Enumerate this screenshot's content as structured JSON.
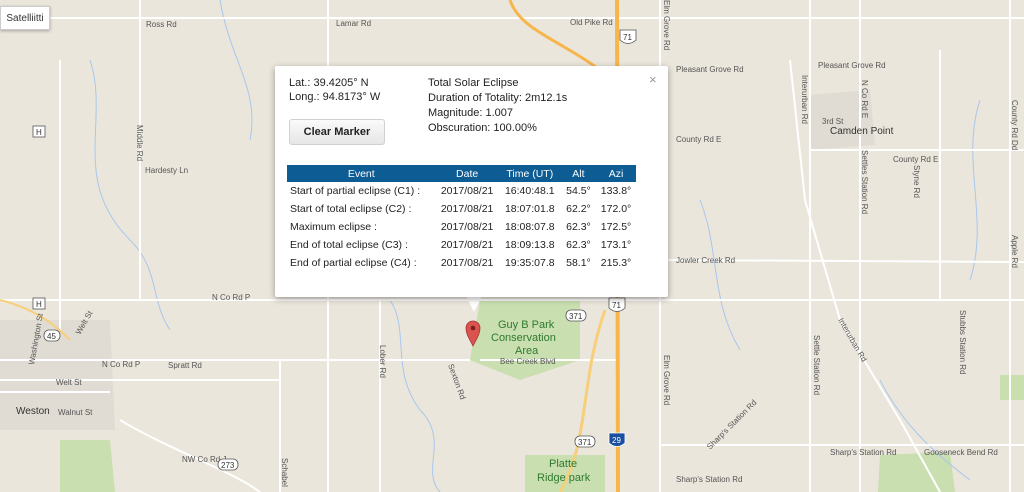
{
  "controls": {
    "satellite_label": "Satelliitti"
  },
  "map_labels": {
    "ross_rd": "Ross Rd",
    "lamar_rd": "Lamar Rd",
    "old_pike_rd": "Old Pike Rd",
    "pleasant_grove_rd": "Pleasant Grove Rd",
    "pleasant_grove_rd_2": "Pleasant Grove Rd",
    "interurban_rd": "Interurban Rd",
    "n_co_rd_e": "N Co Rd E",
    "camden_point": "Camden Point",
    "county_rd_e": "County Rd E",
    "county_rd_e_2": "County Rd E",
    "settles_station_rd": "Settles Station Rd",
    "styne_rd": "Styne Rd",
    "third_st": "3rd St",
    "middle_rd": "Middle Rd",
    "hardesty_ln": "Hardesty Ln",
    "n_co_rd_p": "N Co Rd P",
    "n_co_rd_p_2": "N Co Rd P",
    "spratt_rd": "Spratt Rd",
    "lober_rd": "Lober Rd",
    "sexton_rd": "Sexton Rd",
    "bee_creek_blvd": "Bee Creek Blvd",
    "guy_b_park_1": "Guy B Park",
    "guy_b_park_2": "Conservation",
    "guy_b_park_3": "Area",
    "elm_grove_rd": "Elm Grove Rd",
    "settle_station_rd": "Settle Station Rd",
    "interurban_rd_2": "Interurban Rd",
    "jowler_creek_rd": "Jowler Creek Rd",
    "stubbs_station_rd": "Stubbs Station Rd",
    "apple_rd": "Apple Rd",
    "weston": "Weston",
    "walnut_st": "Walnut St",
    "washington_st": "Washington St",
    "welt_st": "Welt St",
    "nw_co_rd_j": "NW Co Rd J",
    "schabel": "Schabel",
    "sharps_station_rd": "Sharp's Station Rd",
    "sharps_station_rd_2": "Sharp's Station Rd",
    "gooseneck_bend_rd": "Gooseneck Bend Rd",
    "platte_1": "Platte",
    "platte_2": "Ridge park",
    "elm_grove_rd_top": "Elm Grove Rd",
    "county_rd_dd": "County Rd Dd",
    "shield_71_top": "71",
    "shield_71_mid": "71",
    "shield_371_a": "371",
    "shield_371_b": "371",
    "shield_29": "29",
    "shield_273": "273",
    "shield_45": "45",
    "shield_h_1": "H",
    "shield_h_2": "H"
  },
  "popup": {
    "lat": "Lat.: 39.4205° N",
    "long": "Long.: 94.8173° W",
    "eclipse_type": "Total Solar Eclipse",
    "duration": "Duration of Totality: 2m12.1s",
    "magnitude": "Magnitude: 1.007",
    "obscuration": "Obscuration: 100.00%",
    "clear_marker": "Clear Marker",
    "close_symbol": "×",
    "table": {
      "headers": [
        "Event",
        "Date",
        "Time (UT)",
        "Alt",
        "Azi"
      ],
      "rows": [
        [
          "Start of partial eclipse (C1) :",
          "2017/08/21",
          "16:40:48.1",
          "54.5°",
          "133.8°"
        ],
        [
          "Start of total eclipse (C2) :",
          "2017/08/21",
          "18:07:01.8",
          "62.2°",
          "172.0°"
        ],
        [
          "Maximum eclipse :",
          "2017/08/21",
          "18:08:07.8",
          "62.3°",
          "172.5°"
        ],
        [
          "End of total eclipse (C3) :",
          "2017/08/21",
          "18:09:13.8",
          "62.3°",
          "173.1°"
        ],
        [
          "End of partial eclipse (C4) :",
          "2017/08/21",
          "19:35:07.8",
          "58.1°",
          "215.3°"
        ]
      ]
    }
  },
  "colors": {
    "map_bg": "#ebe6dc",
    "park": "#c9dfaf",
    "highway": "#f7b64b",
    "table_header": "#0d5c94",
    "marker": "#d9534f"
  }
}
